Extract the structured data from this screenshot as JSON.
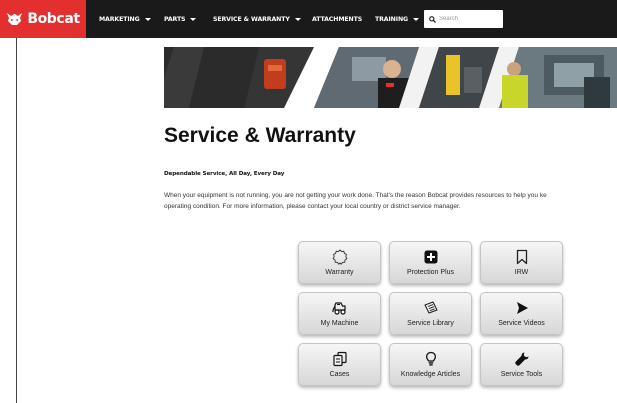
{
  "brand": {
    "name": "Bobcat",
    "color": "#e3302f"
  },
  "nav": {
    "items": [
      {
        "label": "Marketing",
        "dropdown": true
      },
      {
        "label": "Parts",
        "dropdown": true
      },
      {
        "label": "Service & Warranty",
        "dropdown": true
      },
      {
        "label": "Attachments",
        "dropdown": false
      },
      {
        "label": "Training",
        "dropdown": true
      }
    ],
    "search_placeholder": "Search"
  },
  "page": {
    "title": "Service & Warranty",
    "subheading": "Dependable Service, All Day, Every Day",
    "intro_lines": [
      "When your equipment is not running, you are not getting your work done. That's the reason Bobcat provides resources to help you ke",
      "operating condition. For more information, please contact your local country or district service manager."
    ]
  },
  "tiles": [
    {
      "label": "Warranty",
      "icon": "warranty-badge-icon"
    },
    {
      "label": "Protection Plus",
      "icon": "plus-square-icon"
    },
    {
      "label": "IRW",
      "icon": "bookmark-icon"
    },
    {
      "label": "My Machine",
      "icon": "loader-machine-icon"
    },
    {
      "label": "Service Library",
      "icon": "library-book-icon"
    },
    {
      "label": "Service Videos",
      "icon": "play-video-icon"
    },
    {
      "label": "Cases",
      "icon": "cases-documents-icon"
    },
    {
      "label": "Knowledge Articles",
      "icon": "lightbulb-icon"
    },
    {
      "label": "Service Tools",
      "icon": "wrench-icon"
    }
  ]
}
